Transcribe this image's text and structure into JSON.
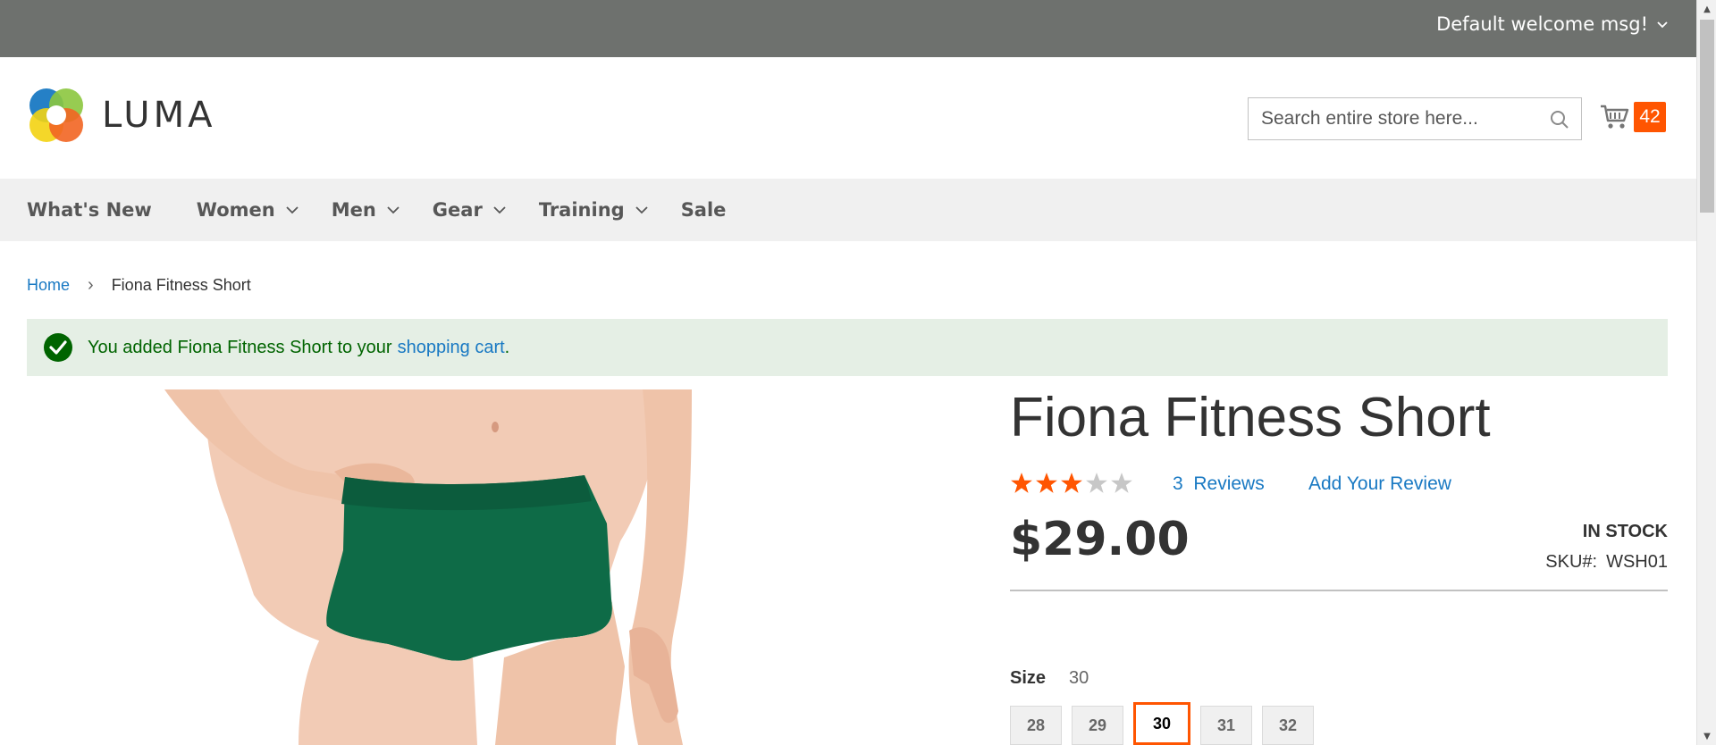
{
  "top_panel": {
    "welcome": "Default welcome msg!"
  },
  "header": {
    "logo_text": "LUMA",
    "search_placeholder": "Search entire store here...",
    "cart_count": "42"
  },
  "nav": {
    "items": [
      {
        "label": "What's New",
        "has_dropdown": false
      },
      {
        "label": "Women",
        "has_dropdown": true
      },
      {
        "label": "Men",
        "has_dropdown": true
      },
      {
        "label": "Gear",
        "has_dropdown": true
      },
      {
        "label": "Training",
        "has_dropdown": true
      },
      {
        "label": "Sale",
        "has_dropdown": false
      }
    ]
  },
  "breadcrumb": {
    "home": "Home",
    "current": "Fiona Fitness Short"
  },
  "message": {
    "text": "You added Fiona Fitness Short to your",
    "link": "shopping cart",
    "end": "."
  },
  "product": {
    "title": "Fiona Fitness Short",
    "rating_stars": 3,
    "rating_max": 5,
    "reviews_count": "3",
    "reviews_label": "Reviews",
    "add_review": "Add Your Review",
    "price": "$29.00",
    "stock": "IN STOCK",
    "sku_label": "SKU#:",
    "sku_value": "WSH01",
    "size_label": "Size",
    "size_selected": "30",
    "sizes": [
      "28",
      "29",
      "30",
      "31",
      "32"
    ]
  },
  "colors": {
    "accent": "#ff5501",
    "link": "#1979c3",
    "panel": "#6e716e",
    "nav_bg": "#f0f0f0",
    "success_bg": "#e5efe5",
    "success_text": "#006400",
    "short_green": "#0e6b47"
  }
}
